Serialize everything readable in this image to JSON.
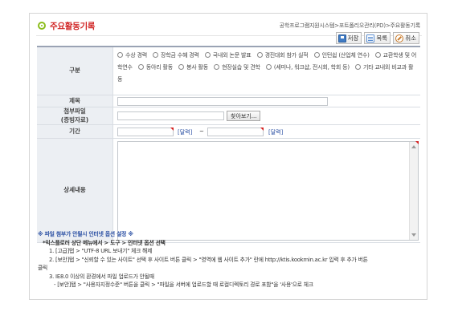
{
  "header": {
    "title": "주요활동기록",
    "breadcrumb": "공학프로그램지원시스템>포트폴리오관리(PD)>주요활동기록"
  },
  "toolbar": {
    "save_label": "저장",
    "list_label": "목록",
    "cancel_label": "취소"
  },
  "form": {
    "type_label": "구분",
    "type_options": [
      "수상 경력",
      "장학금 수혜 경력",
      "국내외 논문 발표",
      "경진대회 참가 실적",
      "인턴쉽 (산업체 연수)",
      "교환학생 및 어학연수",
      "동아리 활동",
      "봉사 활동",
      "현장실습 및 견학",
      "(세미나, 워크샵, 전시회, 학회 등)",
      "기타 교내외 비교과 활동"
    ],
    "title_label": "제목",
    "title_value": "",
    "file_label_line1": "첨부파일",
    "file_label_line2": "(증빙자료)",
    "file_value": "",
    "find_button": "찾아보기...",
    "period_label": "기간",
    "date_start": "",
    "date_end": "",
    "calendar_label": "[달력]",
    "period_separator": "~",
    "detail_label": "상세내용",
    "detail_value": ""
  },
  "notice": {
    "title": "※ 파일 첨부가 안될시 인터넷 옵션 설정 ※",
    "path": "*익스플로러 상단 메뉴에서 > 도구 > 인터넷 옵션 선택",
    "step1": "1. [고급]탭 > \"UTF-8 URL 보내기\" 체크 해제",
    "step2a": "2. [보안]탭 > \"신뢰할 수 있는 사이트\" 선택 후 사이트 버튼 클릭 > \"영역에 웹 사이트 추가\" 란에 http://ktis.kookmin.ac.kr 입력 후 추가 버튼",
    "step2b": "클릭",
    "step3": "3. IE8.0 이상의 환경에서 파일 업로드가 안될때",
    "step3_detail": "- [보안]탭 > \"사용자지정수준\" 버튼을 클릭 > \"파일을 서버에 업로드할 때 로컬디렉토리 경로 포함\"을 '사용'으로 체크"
  }
}
